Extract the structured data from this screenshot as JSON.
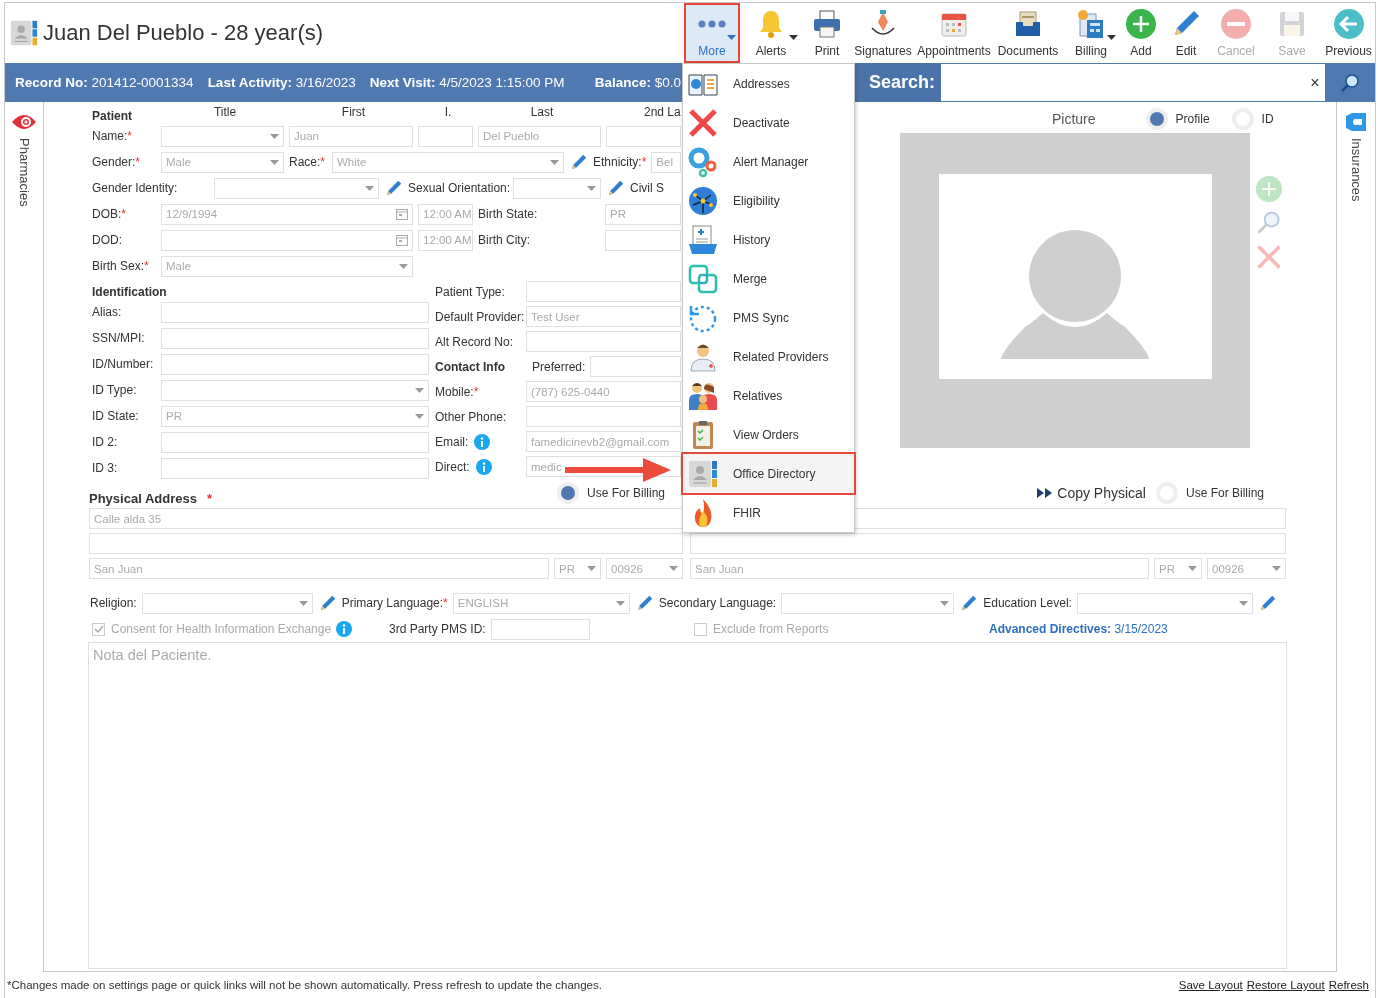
{
  "header": {
    "title": "Juan Del Pueblo - 28 year(s)"
  },
  "toolbar": [
    {
      "label": "More",
      "selected": true,
      "disabled": false,
      "dropdown": true
    },
    {
      "label": "Alerts",
      "selected": false,
      "disabled": false,
      "dropdown": true
    },
    {
      "label": "Print",
      "selected": false,
      "disabled": false,
      "dropdown": false
    },
    {
      "label": "Signatures",
      "selected": false,
      "disabled": false,
      "dropdown": false
    },
    {
      "label": "Appointments",
      "selected": false,
      "disabled": false,
      "dropdown": false
    },
    {
      "label": "Documents",
      "selected": false,
      "disabled": false,
      "dropdown": false
    },
    {
      "label": "Billing",
      "selected": false,
      "disabled": false,
      "dropdown": true
    },
    {
      "label": "Add",
      "selected": false,
      "disabled": false,
      "dropdown": false
    },
    {
      "label": "Edit",
      "selected": false,
      "disabled": false,
      "dropdown": false
    },
    {
      "label": "Cancel",
      "selected": false,
      "disabled": true,
      "dropdown": false
    },
    {
      "label": "Save",
      "selected": false,
      "disabled": true,
      "dropdown": false
    },
    {
      "label": "Previous",
      "selected": false,
      "disabled": false,
      "dropdown": false
    }
  ],
  "info_bar": [
    {
      "label": "Record No:",
      "value": "201412-0001334"
    },
    {
      "label": "Last Activity:",
      "value": "3/16/2023"
    },
    {
      "label": "Next Visit:",
      "value": "4/5/2023 1:15:00 PM"
    },
    {
      "label": "Balance:",
      "value": "$0.0"
    }
  ],
  "search": {
    "label": "Search:",
    "clear": "×"
  },
  "side_tabs": {
    "left": "Pharmacies",
    "right": "Insurances"
  },
  "patient": {
    "heading": "Patient",
    "columns": [
      "Title",
      "First",
      "I.",
      "Last",
      "2nd La"
    ],
    "name": {
      "label": "Name:",
      "mark": "*",
      "first": "Juan",
      "last": "Del Pueblo"
    },
    "gender": {
      "label": "Gender:",
      "mark": "*",
      "value": "Male"
    },
    "race": {
      "label": "Race:",
      "mark": "*",
      "value": "White"
    },
    "ethnicity": {
      "label": "Ethnicity:",
      "mark": "*",
      "value": "Bel"
    },
    "gender_identity": {
      "label": "Gender Identity:"
    },
    "sexual_orientation": {
      "label": "Sexual Orientation:"
    },
    "civil_status": {
      "label": "Civil S"
    },
    "dob": {
      "label": "DOB:",
      "mark": "*",
      "value": "12/9/1994",
      "time": "12:00 AM"
    },
    "birth_state": {
      "label": "Birth State:",
      "value": "PR"
    },
    "dod": {
      "label": "DOD:",
      "time": "12:00 AM"
    },
    "birth_city": {
      "label": "Birth City:"
    },
    "birth_sex": {
      "label": "Birth Sex:",
      "mark": "*",
      "value": "Male"
    }
  },
  "identification": {
    "heading": "Identification",
    "fields": [
      {
        "kind": "text",
        "label": "Alias:"
      },
      {
        "kind": "text",
        "label": "SSN/MPI:"
      },
      {
        "kind": "text",
        "label": "ID/Number:"
      },
      {
        "kind": "select",
        "label": "ID Type:"
      },
      {
        "kind": "select",
        "label": "ID State:",
        "value": "PR"
      },
      {
        "kind": "text",
        "label": "ID 2:"
      },
      {
        "kind": "text",
        "label": "ID 3:"
      }
    ]
  },
  "details": [
    {
      "label": "Patient Type:"
    },
    {
      "label": "Default Provider:",
      "value": "Test User"
    },
    {
      "label": "Alt Record No:"
    }
  ],
  "contact": {
    "heading": "Contact Info",
    "preferred": "Preferred:",
    "fields": [
      {
        "label": "Mobile:",
        "mark": "*",
        "info": false,
        "value": "(787) 625-0440"
      },
      {
        "label": "Other Phone:",
        "info": false
      },
      {
        "label": "Email:",
        "info": true,
        "value": "famedicinevb2@gmail.com"
      },
      {
        "label": "Direct:",
        "info": true,
        "value": "medic"
      }
    ]
  },
  "picture": {
    "heading": "Picture",
    "options": [
      {
        "label": "Profile",
        "selected": true
      },
      {
        "label": "ID",
        "selected": false
      }
    ]
  },
  "physical_address": {
    "heading": "Physical Address",
    "mark": "*",
    "billing": {
      "label": "Use For Billing",
      "selected": true
    },
    "line1": "Calle alda 35",
    "city": "San Juan",
    "state": "PR",
    "zip": "00926"
  },
  "other_address": {
    "copy": "Copy Physical",
    "billing": {
      "label": "Use For Billing",
      "selected": false
    },
    "city": "San Juan",
    "state": "PR",
    "zip": "00926"
  },
  "demographics": [
    {
      "label": "Religion:"
    },
    {
      "label": "Primary Language:",
      "mark": "*",
      "value": "ENGLISH"
    },
    {
      "label": "Secondary Language:"
    },
    {
      "label": "Education Level:"
    }
  ],
  "consent": {
    "label": "Consent for Health Information Exchange",
    "checked": true
  },
  "pms_id": {
    "label": "3rd Party PMS ID:"
  },
  "exclude": {
    "label": "Exclude from Reports",
    "checked": false
  },
  "advanced_directives": {
    "label": "Advanced Directives:",
    "value": "3/15/2023"
  },
  "notes": {
    "placeholder": "Nota del Paciente."
  },
  "menu": [
    {
      "label": "Addresses",
      "selected": false
    },
    {
      "label": "Deactivate",
      "selected": false
    },
    {
      "label": "Alert Manager",
      "selected": false
    },
    {
      "label": "Eligibility",
      "selected": false
    },
    {
      "label": "History",
      "selected": false
    },
    {
      "label": "Merge",
      "selected": false
    },
    {
      "label": "PMS Sync",
      "selected": false
    },
    {
      "label": "Related Providers",
      "selected": false
    },
    {
      "label": "Relatives",
      "selected": false
    },
    {
      "label": "View Orders",
      "selected": false
    },
    {
      "label": "Office Directory",
      "selected": true
    },
    {
      "label": "FHIR",
      "selected": false
    }
  ],
  "footer": {
    "note": "*Changes made on settings page or quick links will not be shown automatically. Press refresh to update the changes.",
    "links": [
      "Save Layout",
      "Restore Layout",
      "Refresh"
    ]
  }
}
